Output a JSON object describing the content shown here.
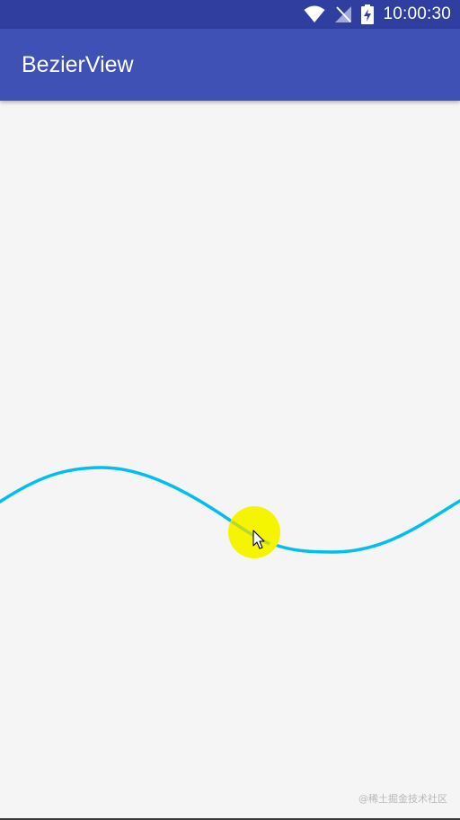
{
  "status_bar": {
    "time": "10:00:30",
    "icons": [
      "wifi-icon",
      "signal-off-icon",
      "battery-charging-icon"
    ],
    "color": "#303f9f"
  },
  "app_bar": {
    "title": "BezierView",
    "color": "#3f51b5"
  },
  "bezier_view": {
    "curve_color": "#00bfef",
    "control_point_color": "#f5f500",
    "cursor_icon": "mouse-pointer-icon"
  },
  "watermark": "@稀土掘金技术社区"
}
